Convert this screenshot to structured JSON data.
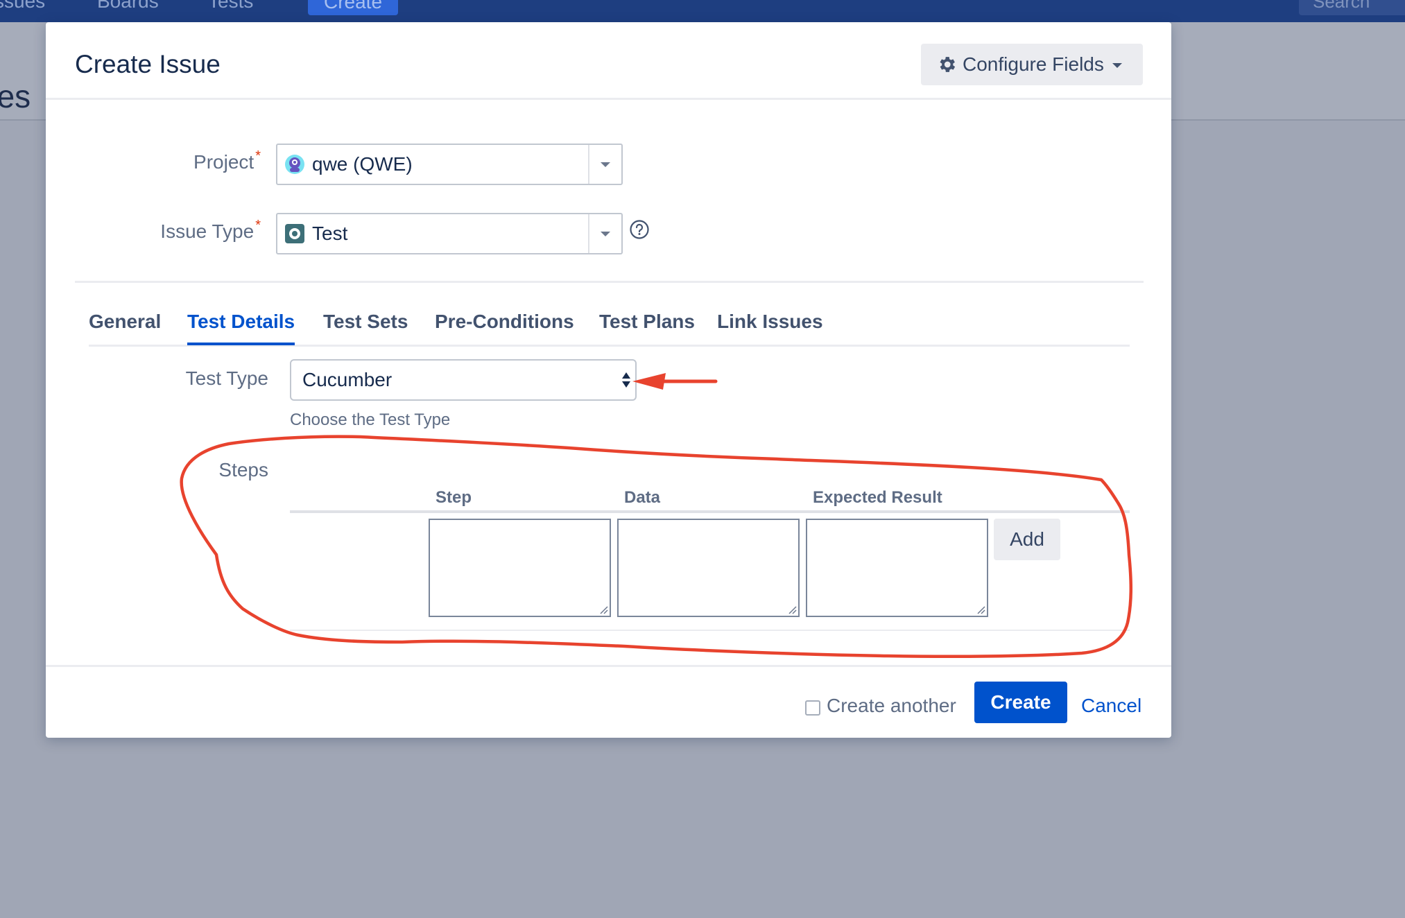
{
  "background": {
    "nav_items": [
      "ssues",
      "Boards",
      "Tests"
    ],
    "create_label": "Create",
    "search_placeholder": "Search",
    "page_title_fragment": "ues"
  },
  "dialog": {
    "title": "Create Issue",
    "configure_fields_label": "Configure Fields",
    "project": {
      "label": "Project",
      "required_mark": "*",
      "value": "qwe (QWE)"
    },
    "issue_type": {
      "label": "Issue Type",
      "required_mark": "*",
      "value": "Test"
    },
    "tabs": [
      {
        "label": "General",
        "active": false
      },
      {
        "label": "Test Details",
        "active": true
      },
      {
        "label": "Test Sets",
        "active": false
      },
      {
        "label": "Pre-Conditions",
        "active": false
      },
      {
        "label": "Test Plans",
        "active": false
      },
      {
        "label": "Link Issues",
        "active": false
      }
    ],
    "test_type": {
      "label": "Test Type",
      "value": "Cucumber",
      "description": "Choose the Test Type"
    },
    "steps": {
      "label": "Steps",
      "columns": [
        "Step",
        "Data",
        "Expected Result"
      ],
      "step_value": "",
      "data_value": "",
      "expected_value": "",
      "add_label": "Add"
    },
    "footer": {
      "create_another_label": "Create another",
      "create_another_checked": false,
      "create_label": "Create",
      "cancel_label": "Cancel"
    }
  },
  "colors": {
    "primary": "#0052cc",
    "topbar": "#1e3e80",
    "annotation": "#e8432e",
    "required": "#de350b"
  }
}
